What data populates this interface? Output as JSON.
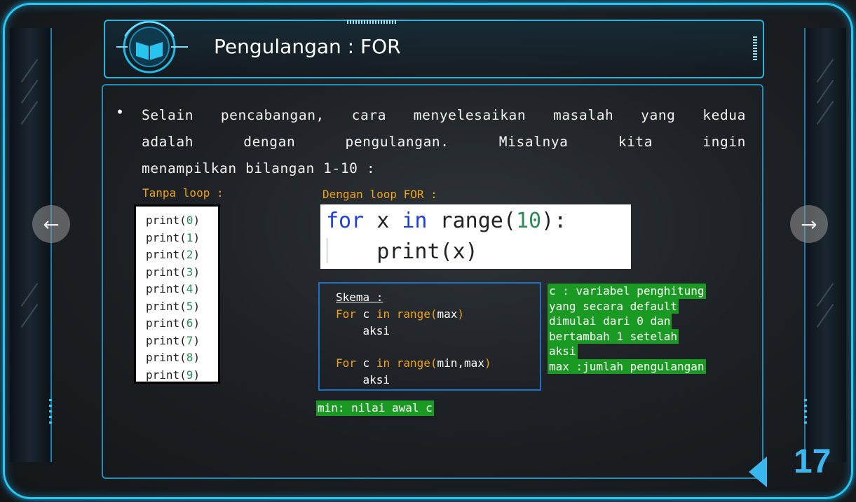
{
  "slide": {
    "title": "Pengulangan : FOR",
    "page_number": "17",
    "bullet": "•",
    "paragraph_lines": [
      "Selain pencabangan, cara menyelesaikan masalah yang kedua",
      "adalah dengan pengulangan. Misalnya kita ingin",
      "menampilkan bilangan 1-10 :"
    ],
    "tanpa_label": "Tanpa loop :",
    "dengan_label": "Dengan loop FOR :",
    "tanpa_lines": [
      {
        "fn": "print(",
        "num": "0",
        "end": ")"
      },
      {
        "fn": "print(",
        "num": "1",
        "end": ")"
      },
      {
        "fn": "print(",
        "num": "2",
        "end": ")"
      },
      {
        "fn": "print(",
        "num": "3",
        "end": ")"
      },
      {
        "fn": "print(",
        "num": "4",
        "end": ")"
      },
      {
        "fn": "print(",
        "num": "5",
        "end": ")"
      },
      {
        "fn": "print(",
        "num": "6",
        "end": ")"
      },
      {
        "fn": "print(",
        "num": "7",
        "end": ")"
      },
      {
        "fn": "print(",
        "num": "8",
        "end": ")"
      },
      {
        "fn": "print(",
        "num": "9",
        "end": ")"
      }
    ],
    "for_code": {
      "kw_for": "for",
      "var": " x ",
      "kw_in": "in",
      "range_open": " range(",
      "num": "10",
      "range_close": "):",
      "body": "    print(x)"
    },
    "skema": {
      "title": "Skema :",
      "line1_for": "For",
      "line1_c": " c ",
      "line1_in": "in",
      "line1_range": " range(",
      "line1_arg": "max",
      "line1_close": ")",
      "line2": "    aksi",
      "line3_for": "For",
      "line3_c": " c ",
      "line3_in": "in",
      "line3_range": " range(",
      "line3_arg": "min,max",
      "line3_close": ")",
      "line4": "    aksi"
    },
    "notes_right": [
      "c : variabel penghitung ",
      "yang secara default ",
      "dimulai dari 0 dan ",
      "bertambah 1 setelah ",
      "aksi",
      "max :jumlah pengulangan"
    ],
    "note_min": "min: nilai awal c",
    "nav": {
      "prev": "←",
      "next": "→"
    }
  },
  "colors": {
    "accent": "#27c7f2",
    "keyword_orange": "#f0a31a",
    "note_green": "#1a9a22",
    "code_blue": "#1f3fd6",
    "code_green": "#2e8b57"
  }
}
